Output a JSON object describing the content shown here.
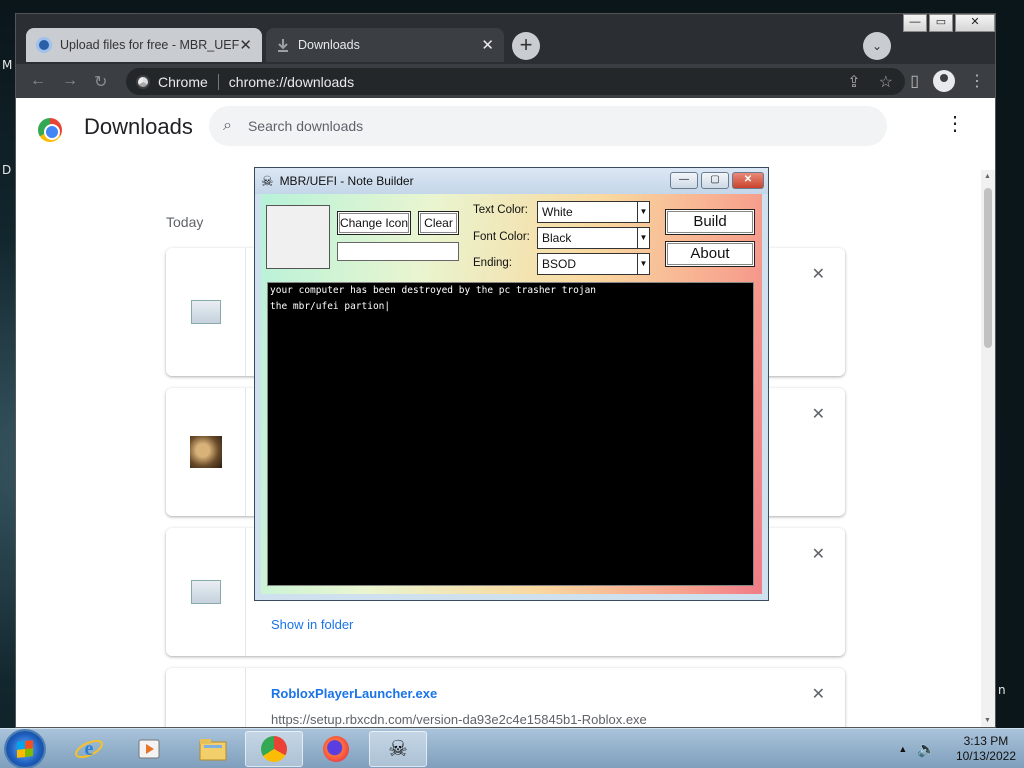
{
  "desktop": {
    "edge_letters": [
      "M",
      "D",
      "n"
    ]
  },
  "chrome": {
    "tabs": [
      {
        "title": "Upload files for free - MBR_UEFI",
        "icon": "upload-site-icon"
      },
      {
        "title": "Downloads",
        "icon": "download-icon"
      }
    ],
    "new_tab": "+",
    "close_glyph": "✕",
    "omnibox": {
      "site_label": "Chrome",
      "url": "chrome://downloads"
    }
  },
  "downloads": {
    "title": "Downloads",
    "search_placeholder": "Search downloads",
    "date_label": "Today",
    "items": [
      {
        "icon": "setup-file-icon"
      },
      {
        "icon": "image-thumbnail-icon"
      },
      {
        "icon": "installer-file-icon",
        "action": "Show in folder"
      },
      {
        "icon": "exe-file-icon",
        "filename": "RobloxPlayerLauncher.exe",
        "url": "https://setup.rbxcdn.com/version-da93e2c4e15845b1-Roblox.exe"
      }
    ]
  },
  "dialog": {
    "title": "MBR/UEFI - Note Builder",
    "change_icon_label": "Change Icon",
    "clear_label": "Clear",
    "text_color_label": "Text Color:",
    "text_color_value": "White",
    "font_color_label": "Font Color:",
    "font_color_value": "Black",
    "ending_label": "Ending:",
    "ending_value": "BSOD",
    "build_label": "Build",
    "about_label": "About",
    "note_text": "your computer has been destroyed by the pc trasher trojan\nthe mbr/ufei partion|"
  },
  "taskbar": {
    "apps": [
      "internet-explorer-icon",
      "media-player-icon",
      "file-explorer-icon",
      "chrome-icon",
      "firefox-icon",
      "note-builder-icon"
    ],
    "time": "3:13 PM",
    "date": "10/13/2022"
  },
  "colors": {
    "accent_link": "#1a73e8",
    "dialog_close": "#c9432d"
  }
}
